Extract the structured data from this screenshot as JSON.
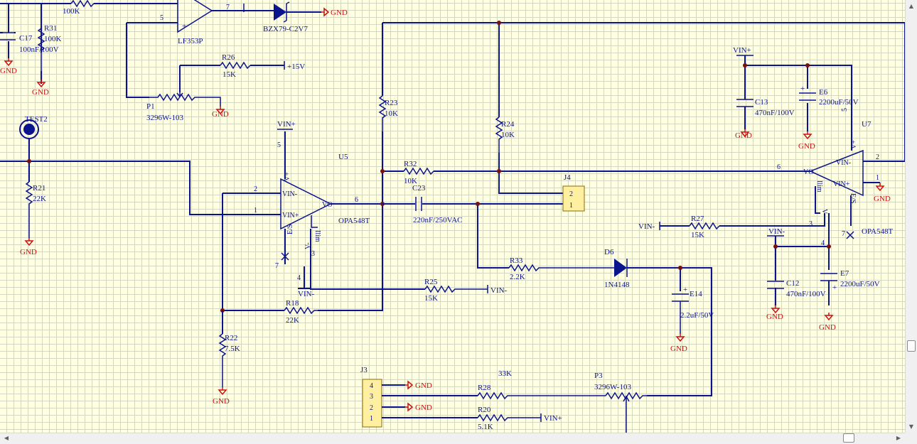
{
  "labels": {
    "res_100k_top": "100K",
    "c17": "C17",
    "c17_val": "100nF/100V",
    "r31": "R31",
    "r31_val": "100K",
    "u_lf353_pin5": "5",
    "u_lf353_pin7": "7",
    "u_lf353": "LF353P",
    "d_bzx": "BZX79-C2V7",
    "r26": "R26",
    "r26_val": "15K",
    "plus15": "+15V",
    "p1": "P1",
    "p1_val": "3296W-103",
    "test2": "TEST2",
    "r21": "R21",
    "r21_val": "22K",
    "r23": "R23",
    "r23_val": "10K",
    "r24": "R24",
    "r24_val": "10K",
    "r32": "R32",
    "r32_val": "10K",
    "c23": "C23",
    "c23_val": "220nF/250VAC",
    "j4": "J4",
    "j4_p2": "2",
    "j4_p1": "1",
    "u5": "U5",
    "u5_part": "OPA548T",
    "u5_vp": "V+",
    "u5_vinm": "VIN-",
    "u5_vinp": "VIN+",
    "u5_vo": "VO",
    "u5_es": "E/S",
    "u5_ilim": "Ilim",
    "u5_vm": "V-",
    "u5_p5": "5",
    "u5_p2": "2",
    "u5_p1": "1",
    "u5_p6": "6",
    "u5_p7": "7",
    "u5_p4": "4",
    "u5_p3": "3",
    "vinp_u5": "VIN+",
    "vinm_u5": "VIN-",
    "r25": "R25",
    "r25_val": "15K",
    "vinm_r25": "VIN-",
    "r18": "R18",
    "r18_val": "22K",
    "r22": "R22",
    "r22_val": "7.5K",
    "r33": "R33",
    "r33_val": "2.2K",
    "d6": "D6",
    "d6_val": "1N4148",
    "e14": "E14",
    "e14_val": "2.2uF/50V",
    "j3": "J3",
    "j3_p4": "4",
    "j3_p3": "3",
    "j3_p2": "2",
    "j3_p1": "1",
    "r28": "R28",
    "r28_val": "33K",
    "r20": "R20",
    "r20_val": "5.1K",
    "vinp_r20": "VIN+",
    "p3": "P3",
    "p3_val": "3296W-103",
    "vinp_top": "VIN+",
    "c13": "C13",
    "c13_val": "470nF/100V",
    "e6": "E6",
    "e6_val": "2200uF/50V",
    "u7": "U7",
    "u7_part": "OPA548T",
    "u7_vp": "V+",
    "u7_vinm": "VIN-",
    "u7_vinp": "VIN+",
    "u7_vo": "VO",
    "u7_es": "E/S",
    "u7_ilim": "Ilim",
    "u7_vm": "V-",
    "u7_p5": "5",
    "u7_p2": "2",
    "u7_p1": "1",
    "u7_p6": "6",
    "u7_p3": "3",
    "u7_p4": "4",
    "u7_p7": "7",
    "vinm_r27": "VIN-",
    "r27": "R27",
    "r27_val": "15K",
    "vinm_c12": "VIN-",
    "c12": "C12",
    "c12_val": "470nF/100V",
    "e7": "E7",
    "e7_val": "2200uF/50V",
    "gnd": "GND"
  },
  "colors": {
    "wire": "#0A148C",
    "ground": "#CC1010",
    "junction": "#7A1010",
    "sheet": "#FFFFE1",
    "grid": "#D5D5C4",
    "connector": "#FFEFA0"
  }
}
